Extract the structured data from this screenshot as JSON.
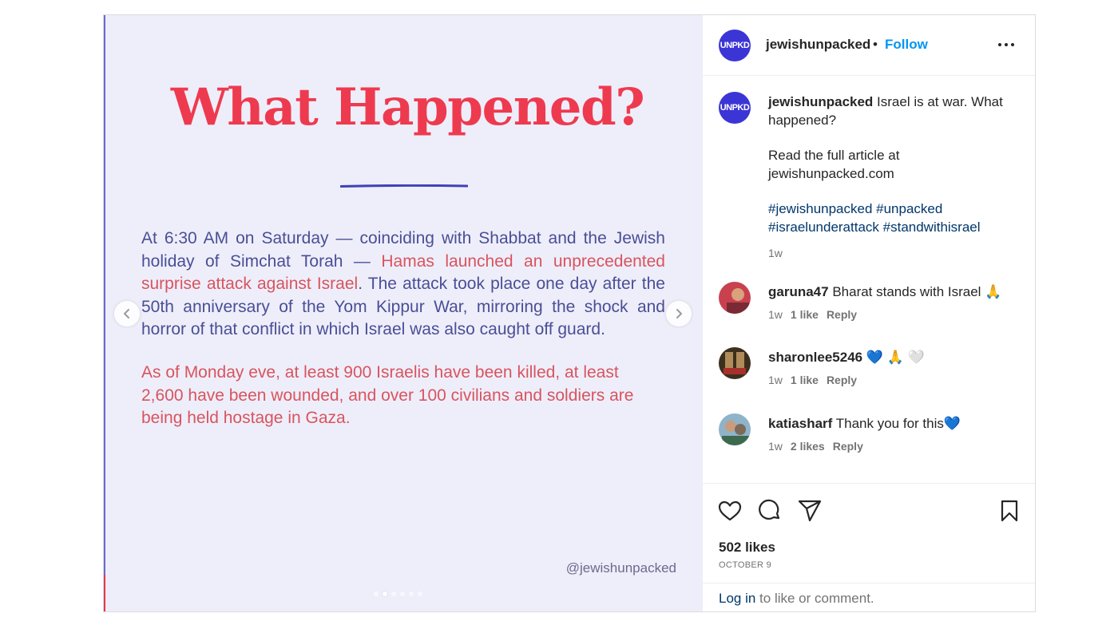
{
  "post": {
    "slide": {
      "title": "What Happened?",
      "p1_blue_a": "At 6:30 AM on Saturday — coinciding with Shabbat and the Jewish holiday of Simchat Torah — ",
      "p1_red": "Hamas launched an unprecedented surprise attack against Israel",
      "p1_blue_b": ". The attack took place one day after the 50th anniversary of the Yom Kippur War, mirroring the shock and horror of that conflict in which Israel was also caught off guard.",
      "p2": "As of Monday eve, at least 900 Israelis have been killed, at least 2,600 have been wounded, and over 100 civilians and soldiers are being held hostage in Gaza.",
      "handle": "@jewishunpacked",
      "dots": 6,
      "active_dot": 1
    },
    "header": {
      "avatar_text": "UNPKD",
      "username": "jewishunpacked",
      "separator": "•",
      "follow_label": "Follow"
    },
    "caption": {
      "username": "jewishunpacked",
      "text": " Israel is at war. What happened?",
      "line2": "Read the full article at jewishunpacked.com",
      "hashtags": "#jewishunpacked #unpacked #israelunderattack #standwithisrael",
      "time": "1w"
    },
    "comments": [
      {
        "username": "garuna47",
        "text": " Bharat stands with Israel 🙏",
        "time": "1w",
        "likes": "1 like",
        "reply": "Reply"
      },
      {
        "username": "sharonlee5246",
        "text": " 💙 🙏 🤍",
        "time": "1w",
        "likes": "1 like",
        "reply": "Reply"
      },
      {
        "username": "katiasharf",
        "text": " Thank you for this💙",
        "time": "1w",
        "likes": "2 likes",
        "reply": "Reply"
      }
    ],
    "actions": {
      "likes": "502 likes",
      "date": "OCTOBER 9"
    },
    "login": {
      "link": "Log in",
      "rest": " to like or comment."
    },
    "colors": {
      "accent_blue": "#0095f6",
      "title_red": "#ee3a4f",
      "slide_bg": "#eeeefa",
      "avatar_blue": "#3b35d6"
    }
  }
}
